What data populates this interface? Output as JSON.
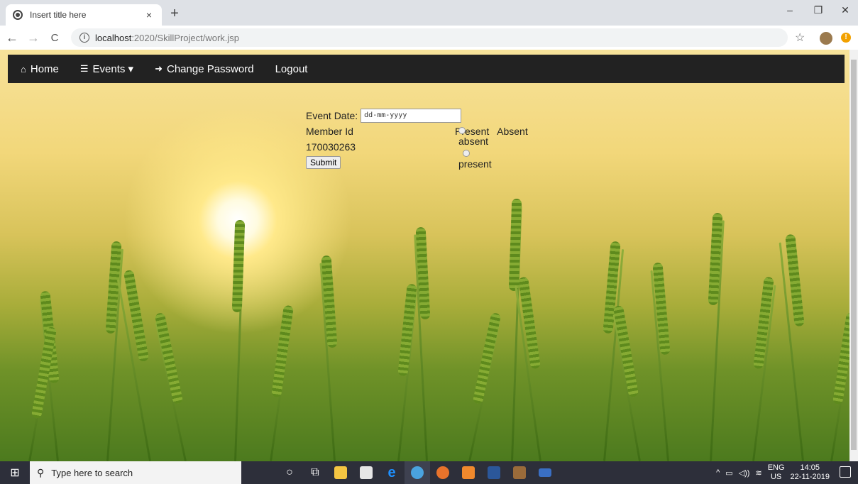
{
  "browser": {
    "tab_title": "Insert title here",
    "tab_close": "×",
    "new_tab": "+",
    "url_host": "localhost",
    "url_path": ":2020/SkillProject/work.jsp",
    "window_controls": {
      "minimize": "–",
      "maximize": "❐",
      "close": "✕"
    },
    "nav": {
      "back": "←",
      "forward": "→",
      "reload": "C"
    }
  },
  "app_nav": {
    "items": [
      {
        "icon": "home-icon",
        "glyph": "⌂",
        "label": "Home"
      },
      {
        "icon": "server-icon",
        "glyph": "☰",
        "label": "Events ▾"
      },
      {
        "icon": "sign-in-icon",
        "glyph": "➜",
        "label": "Change Password"
      },
      {
        "icon": "",
        "glyph": "",
        "label": "Logout"
      }
    ]
  },
  "form": {
    "event_date_label": "Event Date:",
    "event_date_placeholder": "dd-mm-yyyy",
    "member_id_header": "Member Id",
    "status_header": "Present   Absent",
    "member_id": "170030263",
    "radio_absent": "absent",
    "radio_present": "present",
    "submit_label": "Submit"
  },
  "taskbar": {
    "search_placeholder": "Type here to search",
    "lang_top": "ENG",
    "lang_bottom": "US",
    "time": "14:05",
    "date": "22-11-2019"
  }
}
